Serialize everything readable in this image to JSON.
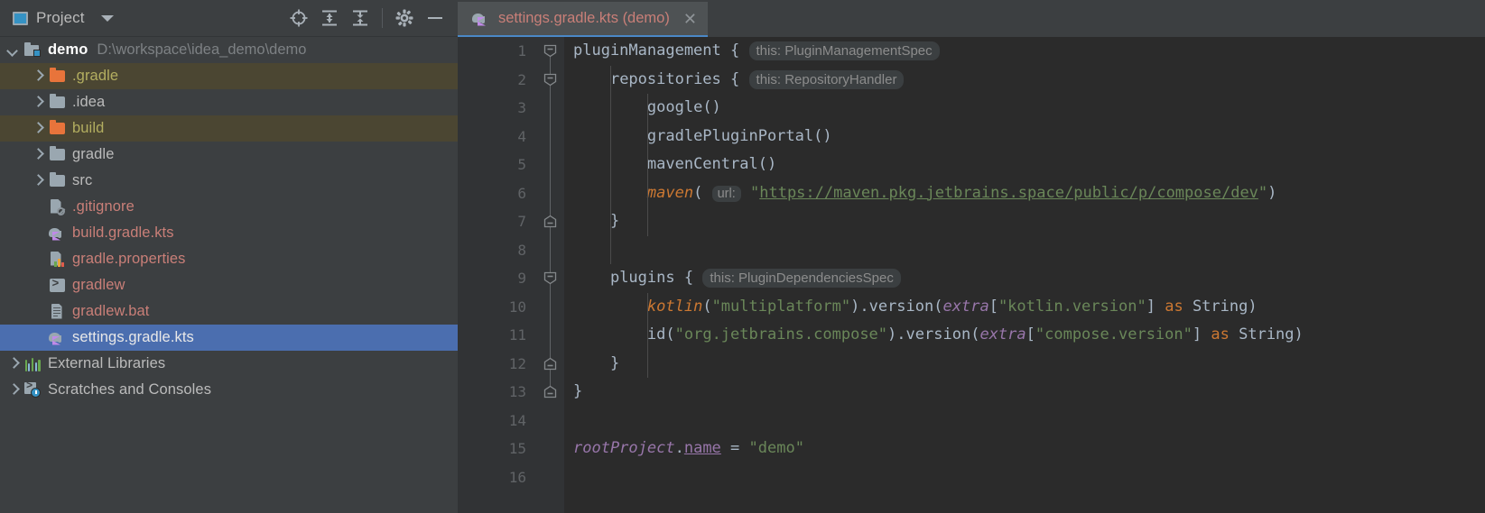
{
  "sidebar": {
    "panel_title": "Project",
    "panel_icon": "project-panel-icon",
    "dropdown_icon": "chevron-down-icon",
    "tools": [
      {
        "name": "locate-icon",
        "label": "Select Opened File"
      },
      {
        "name": "expand-all-icon",
        "label": "Expand All"
      },
      {
        "name": "collapse-all-icon",
        "label": "Collapse All"
      },
      {
        "name": "gear-icon",
        "label": "Settings"
      },
      {
        "name": "minimize-icon",
        "label": "Hide"
      }
    ],
    "tree": [
      {
        "label": "demo",
        "path": "D:\\workspace\\idea_demo\\demo",
        "icon": "module-icon",
        "arrow": "open",
        "indent": 0,
        "style": "bold",
        "highlight": "none"
      },
      {
        "label": ".gradle",
        "path": "",
        "icon": "folder-orange-icon",
        "arrow": "closed",
        "indent": 1,
        "style": "yellow",
        "highlight": "gradle"
      },
      {
        "label": ".idea",
        "path": "",
        "icon": "folder-grey-icon",
        "arrow": "closed",
        "indent": 1,
        "style": "grey",
        "highlight": "none"
      },
      {
        "label": "build",
        "path": "",
        "icon": "folder-orange-icon",
        "arrow": "closed",
        "indent": 1,
        "style": "yellow",
        "highlight": "gradle"
      },
      {
        "label": "gradle",
        "path": "",
        "icon": "folder-grey-icon",
        "arrow": "closed",
        "indent": 1,
        "style": "grey",
        "highlight": "none"
      },
      {
        "label": "src",
        "path": "",
        "icon": "folder-grey-icon",
        "arrow": "closed",
        "indent": 1,
        "style": "grey",
        "highlight": "none"
      },
      {
        "label": ".gitignore",
        "path": "",
        "icon": "gitignore-icon",
        "arrow": "none",
        "indent": 1,
        "style": "red",
        "highlight": "none"
      },
      {
        "label": "build.gradle.kts",
        "path": "",
        "icon": "gradle-kts-icon",
        "arrow": "none",
        "indent": 1,
        "style": "red",
        "highlight": "none"
      },
      {
        "label": "gradle.properties",
        "path": "",
        "icon": "properties-icon",
        "arrow": "none",
        "indent": 1,
        "style": "red",
        "highlight": "none"
      },
      {
        "label": "gradlew",
        "path": "",
        "icon": "shell-script-icon",
        "arrow": "none",
        "indent": 1,
        "style": "red",
        "highlight": "none"
      },
      {
        "label": "gradlew.bat",
        "path": "",
        "icon": "bat-file-icon",
        "arrow": "none",
        "indent": 1,
        "style": "red",
        "highlight": "none"
      },
      {
        "label": "settings.gradle.kts",
        "path": "",
        "icon": "gradle-kts-icon",
        "arrow": "none",
        "indent": 1,
        "style": "white",
        "highlight": "selected"
      },
      {
        "label": "External Libraries",
        "path": "",
        "icon": "libraries-icon",
        "arrow": "closed",
        "indent": 0,
        "style": "grey",
        "highlight": "none"
      },
      {
        "label": "Scratches and Consoles",
        "path": "",
        "icon": "scratches-icon",
        "arrow": "closed",
        "indent": 0,
        "style": "grey",
        "highlight": "none"
      }
    ]
  },
  "editor": {
    "tab": {
      "label": "settings.gradle.kts (demo)",
      "icon": "gradle-kts-icon",
      "close_icon": "close-icon"
    },
    "line_numbers": [
      "1",
      "2",
      "3",
      "4",
      "5",
      "6",
      "7",
      "8",
      "9",
      "10",
      "11",
      "12",
      "13",
      "14",
      "15",
      "16"
    ],
    "lines": [
      {
        "n": 1,
        "text": "pluginManagement {",
        "hint": "this: PluginManagementSpec"
      },
      {
        "n": 2,
        "text": "    repositories {",
        "hint": "this: RepositoryHandler"
      },
      {
        "n": 3,
        "text": "        google()",
        "hint": ""
      },
      {
        "n": 4,
        "text": "        gradlePluginPortal()",
        "hint": ""
      },
      {
        "n": 5,
        "text": "        mavenCentral()",
        "hint": ""
      },
      {
        "n": 6,
        "text": "        maven( url: \"https://maven.pkg.jetbrains.space/public/p/compose/dev\")",
        "hint": ""
      },
      {
        "n": 7,
        "text": "    }",
        "hint": ""
      },
      {
        "n": 8,
        "text": "",
        "hint": ""
      },
      {
        "n": 9,
        "text": "    plugins {",
        "hint": "this: PluginDependenciesSpec"
      },
      {
        "n": 10,
        "text": "        kotlin(\"multiplatform\").version(extra[\"kotlin.version\"] as String)",
        "hint": ""
      },
      {
        "n": 11,
        "text": "        id(\"org.jetbrains.compose\").version(extra[\"compose.version\"] as String)",
        "hint": ""
      },
      {
        "n": 12,
        "text": "    }",
        "hint": ""
      },
      {
        "n": 13,
        "text": "}",
        "hint": ""
      },
      {
        "n": 14,
        "text": "",
        "hint": ""
      },
      {
        "n": 15,
        "text": "rootProject.name = \"demo\"",
        "hint": ""
      },
      {
        "n": 16,
        "text": "",
        "hint": ""
      }
    ],
    "param_hints": {
      "url": "url:"
    },
    "strings": {
      "maven_url": "https://maven.pkg.jetbrains.space/public/p/compose/dev",
      "multiplatform": "multiplatform",
      "kotlin_version_key": "kotlin.version",
      "compose_plugin_id": "org.jetbrains.compose",
      "compose_version_key": "compose.version",
      "root_project_name": "demo"
    }
  },
  "colors": {
    "sidebar_bg": "#3c3f41",
    "editor_bg": "#2b2b2b",
    "gutter_bg": "#313335",
    "selection": "#4b6eaf",
    "gradle_row_highlight": "#4b4632",
    "tab_active": "#4e5254",
    "tab_underline": "#4a88c7",
    "string_green": "#6a8759",
    "keyword_orange": "#cc7832",
    "property_purple": "#9876aa",
    "text_default": "#a9b7c6",
    "file_red": "#c97f78",
    "folder_yellow": "#b3ae60",
    "hint_grey": "#8c8c8c"
  }
}
